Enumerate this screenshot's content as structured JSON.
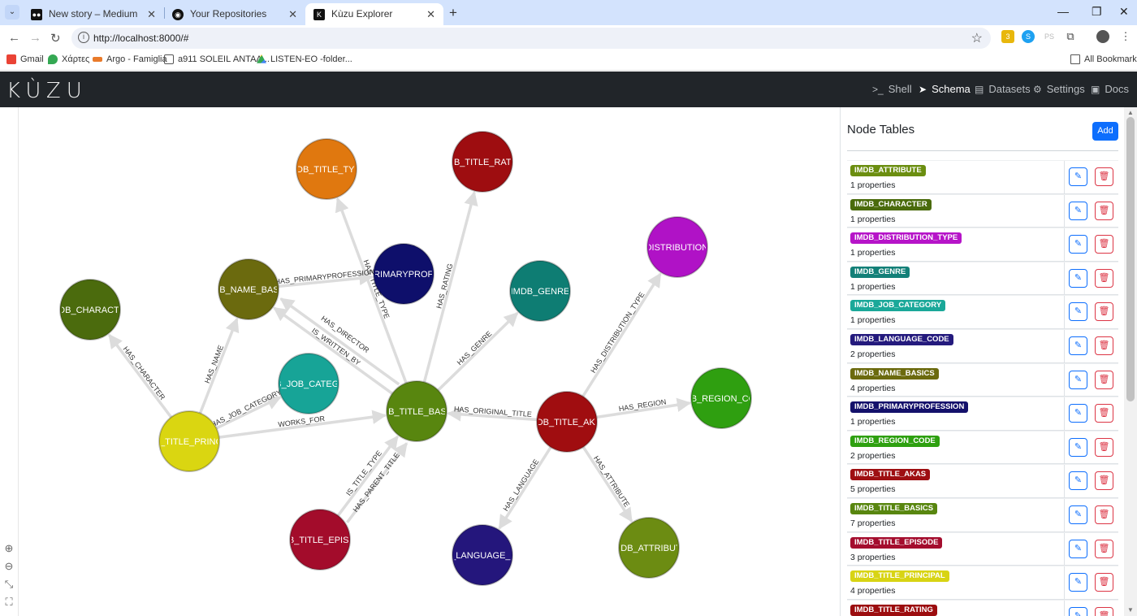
{
  "browser": {
    "tabs": [
      {
        "title": "New story – Medium",
        "icon": "medium-icon",
        "active": false
      },
      {
        "title": "Your Repositories",
        "icon": "github-icon",
        "active": false
      },
      {
        "title": "Kùzu Explorer",
        "icon": "kuzu-icon",
        "active": true
      }
    ],
    "url": "http://localhost:8000/#",
    "bookmarks": [
      "Gmail",
      "Χάρτες",
      "Argo - Famiglia",
      "a911 SOLEIL ΑΝΤΑΛ...",
      "LISTEN-EO -folder..."
    ],
    "all_bookmarks": "All Bookmarks",
    "ext_badge": "3"
  },
  "app": {
    "logo": "KÙZU",
    "nav": [
      {
        "label": "Shell",
        "icon": "terminal-icon",
        "active": false
      },
      {
        "label": "Schema",
        "icon": "send-icon",
        "active": true
      },
      {
        "label": "Datasets",
        "icon": "database-icon",
        "active": false
      },
      {
        "label": "Settings",
        "icon": "gear-icon",
        "active": false
      },
      {
        "label": "Docs",
        "icon": "book-icon",
        "active": false
      }
    ]
  },
  "panel": {
    "title": "Node Tables",
    "add_label": "Add",
    "tables": [
      {
        "name": "IMDB_ATTRIBUTE",
        "props": "1 properties",
        "color": "#6b8e10"
      },
      {
        "name": "IMDB_CHARACTER",
        "props": "1 properties",
        "color": "#4a6b0c"
      },
      {
        "name": "IMDB_DISTRIBUTION_TYPE",
        "props": "1 properties",
        "color": "#b614c8"
      },
      {
        "name": "IMDB_GENRE",
        "props": "1 properties",
        "color": "#138078"
      },
      {
        "name": "IMDB_JOB_CATEGORY",
        "props": "1 properties",
        "color": "#1aa899"
      },
      {
        "name": "IMDB_LANGUAGE_CODE",
        "props": "2 properties",
        "color": "#241a7d"
      },
      {
        "name": "IMDB_NAME_BASICS",
        "props": "4 properties",
        "color": "#6b6a0e"
      },
      {
        "name": "IMDB_PRIMARYPROFESSION",
        "props": "1 properties",
        "color": "#14116b"
      },
      {
        "name": "IMDB_REGION_CODE",
        "props": "2 properties",
        "color": "#2ea010"
      },
      {
        "name": "IMDB_TITLE_AKAS",
        "props": "5 properties",
        "color": "#9e0f12"
      },
      {
        "name": "IMDB_TITLE_BASICS",
        "props": "7 properties",
        "color": "#58860f"
      },
      {
        "name": "IMDB_TITLE_EPISODE",
        "props": "3 properties",
        "color": "#a40d2e"
      },
      {
        "name": "IMDB_TITLE_PRINCIPAL",
        "props": "4 properties",
        "color": "#d8d414"
      },
      {
        "name": "IMDB_TITLE_RATING",
        "props": "",
        "color": "#9c0d0f"
      }
    ]
  },
  "graph": {
    "nodes": [
      {
        "id": "type",
        "label": "IMDB_TITLE_TYPE",
        "color": "#e0780f"
      },
      {
        "id": "rating",
        "label": "IMDB_TITLE_RATING",
        "color": "#9e0d10"
      },
      {
        "id": "prof",
        "label": "IMDB_PRIMARYPROFESSION",
        "color": "#0e0f6b"
      },
      {
        "id": "name",
        "label": "IMDB_NAME_BASICS",
        "color": "#6b6a0e"
      },
      {
        "id": "genre",
        "label": "IMDB_GENRE",
        "color": "#0e7d73"
      },
      {
        "id": "dist",
        "label": "IMDB_DISTRIBUTION_TYPE",
        "color": "#b012c6"
      },
      {
        "id": "char",
        "label": "IMDB_CHARACTER",
        "color": "#4b6b0d"
      },
      {
        "id": "job",
        "label": "IMDB_JOB_CATEGORY",
        "color": "#17a497"
      },
      {
        "id": "basics",
        "label": "IMDB_TITLE_BASICS",
        "color": "#58860f"
      },
      {
        "id": "akas",
        "label": "IMDB_TITLE_AKAS",
        "color": "#a00d10"
      },
      {
        "id": "region",
        "label": "IMDB_REGION_CODE",
        "color": "#2f9f10"
      },
      {
        "id": "principal",
        "label": "IMDB_TITLE_PRINCIPAL",
        "color": "#dad611"
      },
      {
        "id": "episode",
        "label": "IMDB_TITLE_EPISODE",
        "color": "#a30c2b"
      },
      {
        "id": "lang",
        "label": "IMDB_LANGUAGE_CODE",
        "color": "#24167c"
      },
      {
        "id": "attr",
        "label": "IMDB_ATTRIBUTE",
        "color": "#6c8c12"
      }
    ],
    "edges": [
      {
        "from": "basics",
        "to": "type",
        "label": "HAS_TITLE_TYPE"
      },
      {
        "from": "basics",
        "to": "rating",
        "label": "HAS_RATING"
      },
      {
        "from": "basics",
        "to": "genre",
        "label": "HAS_GENRE"
      },
      {
        "from": "name",
        "to": "prof",
        "label": "HAS_PRIMARYPROFESSION"
      },
      {
        "from": "basics",
        "to": "name",
        "label": "IS_WRITTEN_BY"
      },
      {
        "from": "basics",
        "to": "name",
        "label": "HAS_DIRECTOR"
      },
      {
        "from": "principal",
        "to": "char",
        "label": "HAS_CHARACTER"
      },
      {
        "from": "principal",
        "to": "name",
        "label": "HAS_NAME"
      },
      {
        "from": "principal",
        "to": "job",
        "label": "HAS_JOB_CATEGORY"
      },
      {
        "from": "principal",
        "to": "basics",
        "label": "WORKS_FOR"
      },
      {
        "from": "akas",
        "to": "basics",
        "label": "HAS_ORIGINAL_TITLE"
      },
      {
        "from": "akas",
        "to": "dist",
        "label": "HAS_DISTRIBUTION_TYPE"
      },
      {
        "from": "akas",
        "to": "region",
        "label": "HAS_REGION"
      },
      {
        "from": "akas",
        "to": "lang",
        "label": "HAS_LANGUAGE"
      },
      {
        "from": "akas",
        "to": "attr",
        "label": "HAS_ATTRIBUTE"
      },
      {
        "from": "episode",
        "to": "basics",
        "label": "IS_TITLE_TYPE"
      },
      {
        "from": "episode",
        "to": "basics",
        "label": "HAS_PARENT_TITLE"
      }
    ]
  }
}
